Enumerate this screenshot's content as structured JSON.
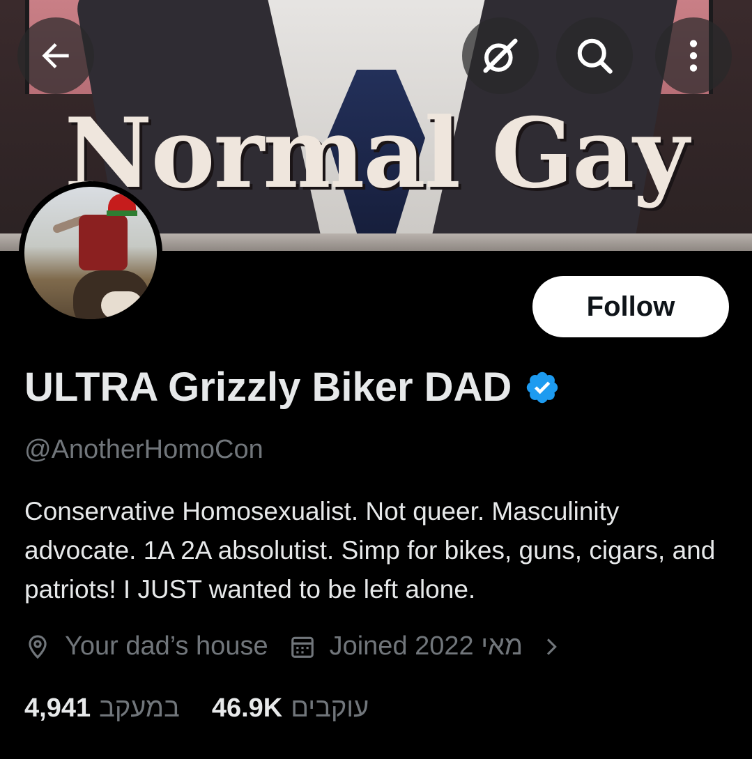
{
  "banner": {
    "title": "Normal Gay"
  },
  "top_nav": {
    "back_icon": "arrow-left-icon",
    "grok_icon": "grok-icon",
    "search_icon": "search-icon",
    "more_icon": "more-vertical-icon"
  },
  "profile": {
    "follow_label": "Follow",
    "display_name": "ULTRA Grizzly Biker DAD",
    "verified": true,
    "verified_color": "#1d9bf0",
    "handle": "@AnotherHomoCon",
    "bio": "Conservative Homosexualist. Not queer. Masculinity advocate. 1A 2A absolutist. Simp for bikes, guns, cigars, and patriots! I JUST wanted to be left alone.",
    "location": "Your dad’s house",
    "location_icon": "location-pin-icon",
    "joined": "Joined 2022 מאי",
    "joined_icon": "calendar-icon",
    "chevron_icon": "chevron-right-icon",
    "following_count": "4,941",
    "following_label": "במעקב",
    "followers_count": "46.9K",
    "followers_label": "עוקבים"
  },
  "colors": {
    "background": "#000000",
    "primary_text": "#e7e9ea",
    "secondary_text": "#71767b",
    "accent": "#1d9bf0"
  }
}
